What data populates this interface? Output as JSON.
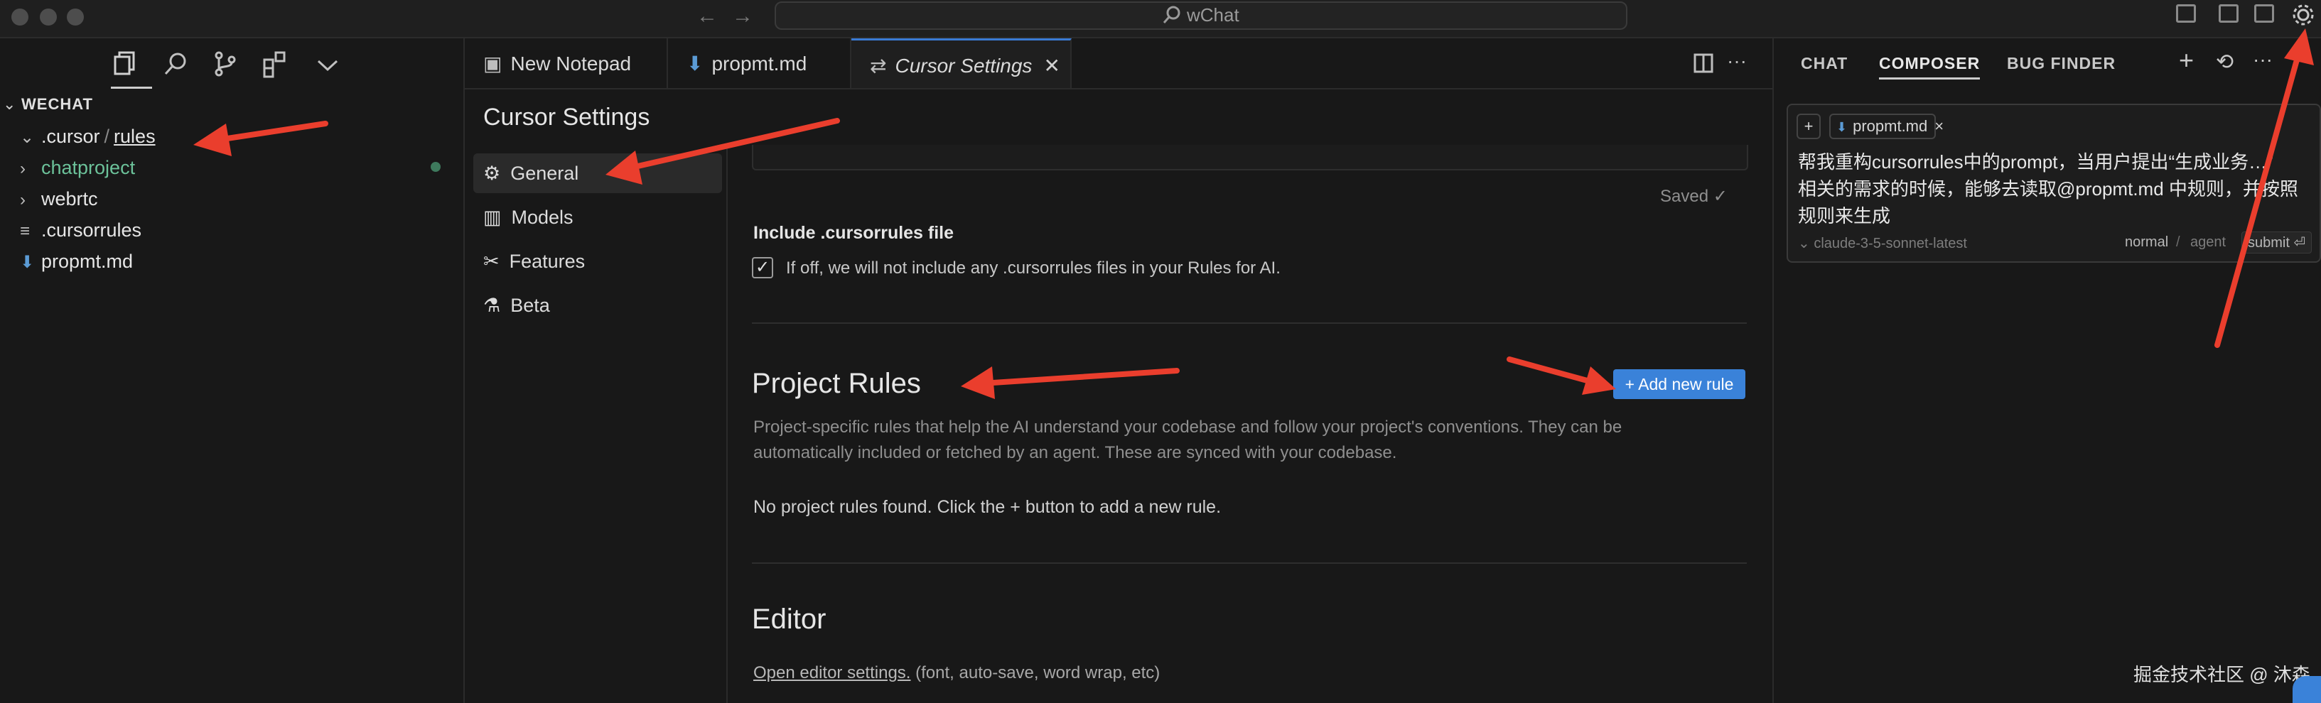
{
  "window": {
    "search_text": "wChat",
    "nav_back": "←",
    "nav_forward": "→"
  },
  "activity_bar": {
    "icons": [
      "files-icon",
      "search-icon",
      "source-control-icon",
      "extensions-icon",
      "chevron-down-icon"
    ]
  },
  "explorer": {
    "section": "WECHAT",
    "items": [
      {
        "chevron": "⌄",
        "label_a": ".cursor",
        "sep": "/",
        "label_b": "rules"
      },
      {
        "chevron": "›",
        "label": "chatproject"
      },
      {
        "chevron": "›",
        "label": "webrtc"
      },
      {
        "icon": "≡",
        "label": ".cursorrules"
      },
      {
        "icon": "⬇",
        "label": "propmt.md"
      }
    ]
  },
  "tabs": [
    {
      "icon": "▣",
      "label": "New Notepad"
    },
    {
      "icon": "⬇",
      "label": "propmt.md"
    },
    {
      "icon": "⇄",
      "label": "Cursor Settings",
      "close": "✕"
    }
  ],
  "settings": {
    "title": "Cursor Settings",
    "nav": [
      {
        "icon": "⚙",
        "label": "General"
      },
      {
        "icon": "▥",
        "label": "Models"
      },
      {
        "icon": "✂",
        "label": "Features"
      },
      {
        "icon": "⚗",
        "label": "Beta"
      }
    ],
    "saved": "Saved ✓",
    "include_title": "Include .cursorrules file",
    "include_desc": "If off, we will not include any .cursorrules files in your Rules for AI.",
    "include_checked": "✓",
    "project_rules_title": "Project Rules",
    "add_rule": "+ Add new rule",
    "project_rules_desc_1": "Project-specific rules that help the AI understand your codebase and follow your project's conventions. They can be",
    "project_rules_desc_2": "automatically included or fetched by an agent. These are synced with your codebase.",
    "no_rules": "No project rules found. Click the + button to add a new rule.",
    "editor_title": "Editor",
    "editor_link": "Open editor settings.",
    "editor_desc": " (font, auto-save, word wrap, etc)"
  },
  "right_panel": {
    "tabs": [
      "CHAT",
      "COMPOSER",
      "BUG FINDER"
    ],
    "actions": [
      "+",
      "⟲",
      "···"
    ],
    "chip_plus": "+",
    "chip_file": "propmt.md",
    "chip_close": "×",
    "prompt_line1": "帮我重构cursorrules中的prompt，当用户提出“生成业务…”",
    "prompt_line2": "相关的需求的时候，能够去读取@propmt.md 中规则，并按照",
    "prompt_line3": "规则来生成",
    "model": "⌄ claude-3-5-sonnet-latest",
    "mode_normal": "normal",
    "mode_sep": "/",
    "mode_agent": "agent",
    "submit": "submit ⏎"
  },
  "watermark": "掘金技术社区 @ 沐森",
  "colors": {
    "accent": "#3a82d9",
    "arrow": "#ea3e2d",
    "green": "#6cc29a"
  }
}
